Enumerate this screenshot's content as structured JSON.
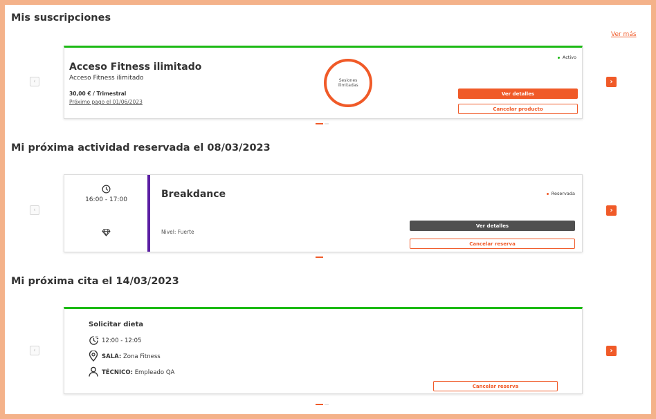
{
  "colors": {
    "accent": "#f05a28",
    "green": "#1cba14",
    "purple": "#5b1fa3",
    "dark_button": "#505050",
    "border": "#f4b28a"
  },
  "subscriptions": {
    "title": "Mis suscripciones",
    "see_more": "Ver más",
    "card": {
      "status": "Activo",
      "name": "Acceso Fitness ilimitado",
      "subtitle": "Acceso Fitness ilimitado",
      "price": "30,00 € / Trimestral",
      "next_payment": "Próximo pago el 01/06/2023",
      "sessions_line1": "Sesiones",
      "sessions_line2": "ilimitadas",
      "details_button": "Ver detalles",
      "cancel_button": "Cancelar producto"
    }
  },
  "activity": {
    "title": "Mi próxima actividad reservada el 08/03/2023",
    "card": {
      "time": "16:00 - 17:00",
      "name": "Breakdance",
      "status": "Reservada",
      "level": "Nivel: Fuerte",
      "details_button": "Ver detalles",
      "cancel_button": "Cancelar reserva"
    }
  },
  "appointment": {
    "title": "Mi próxima cita el 14/03/2023",
    "card": {
      "name": "Solicitar dieta",
      "time": "12:00 - 12:05",
      "room_label": "SALA:",
      "room_value": "Zona Fitness",
      "tech_label": "TÉCNICO:",
      "tech_value": "Empleado QA",
      "cancel_button": "Cancelar reserva"
    }
  },
  "icons": {
    "prev": "chevron-left-icon",
    "next": "chevron-right-icon",
    "clock": "clock-icon",
    "diamond": "diamond-icon",
    "location": "location-pin-icon",
    "person": "person-icon"
  }
}
